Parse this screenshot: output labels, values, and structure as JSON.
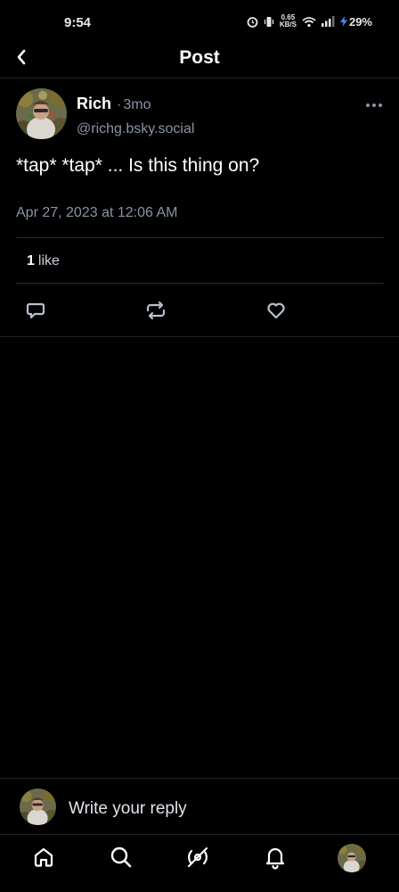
{
  "status_bar": {
    "time": "9:54",
    "net_speed_value": "0.65",
    "net_speed_unit": "KB/S",
    "battery": "29%"
  },
  "header": {
    "title": "Post"
  },
  "post": {
    "author_name": "Rich",
    "separator": "·",
    "relative_time": "3mo",
    "handle": "@richg.bsky.social",
    "text": "*tap* *tap* ... Is this thing on?",
    "timestamp": "Apr 27, 2023 at 12:06 AM",
    "likes_count": "1",
    "likes_label": "like"
  },
  "reply": {
    "placeholder": "Write your reply"
  },
  "colors": {
    "background": "#000000",
    "muted_text": "#8a93a6",
    "divider": "#272b33",
    "icon": "#b8bfcc"
  },
  "icons": {
    "back": "chevron-left-icon",
    "more": "more-horizontal-icon",
    "reply": "comment-icon",
    "repost": "repost-icon",
    "like": "heart-icon",
    "home": "home-icon",
    "search": "search-icon",
    "feeds": "feeds-icon",
    "notifications": "bell-icon"
  }
}
